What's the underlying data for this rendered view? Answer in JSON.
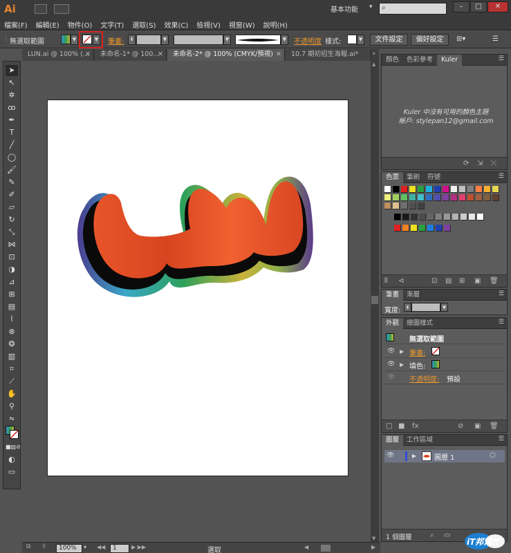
{
  "app": {
    "logo": "Ai",
    "workspace": "基本功能"
  },
  "menu": [
    "檔案(F)",
    "編輯(E)",
    "物件(O)",
    "文字(T)",
    "選取(S)",
    "效果(C)",
    "檢視(V)",
    "視窗(W)",
    "說明(H)"
  ],
  "control": {
    "selection_label": "無選取範圍",
    "stroke_label": "筆畫:",
    "opacity_label": "不透明度",
    "style_label": "樣式:",
    "doc_setup": "文件設定",
    "preferences": "偏好設定"
  },
  "tabs": [
    {
      "label": "LUN.ai @ 100% (...",
      "close": "✕"
    },
    {
      "label": "未命名-1* @ 100...",
      "close": "✕"
    },
    {
      "label": "未命名-2* @ 100% (CMYK/預視)",
      "close": "✕"
    },
    {
      "label": "10.7 期初招生海報.ai*",
      "close": "✕"
    }
  ],
  "canvas": {
    "art_text": "LUN"
  },
  "status": {
    "zoom": "100%",
    "page": "1",
    "tool": "選取"
  },
  "kuler_panel": {
    "tabs": [
      "顏色",
      "色彩參考",
      "Kuler"
    ],
    "message": "Kuler 中沒有可用的顏色主題",
    "account": "帳戶: stylepan12@gmail.com"
  },
  "swatches_panel": {
    "tabs": [
      "色票",
      "筆刷",
      "符號"
    ],
    "colors": [
      "#ffffff",
      "#000000",
      "#e02020",
      "#f0e020",
      "#28a040",
      "#20b0e0",
      "#2040b0",
      "#d0108c",
      "#f0f0f0",
      "#c0c0c0",
      "#808080",
      "#ff8040",
      "#ffb030",
      "#e8d850",
      "#f0f080",
      "#a0d060",
      "#60c060",
      "#40b0a0",
      "#40c0d0",
      "#3070c0",
      "#5050b0",
      "#8040a0",
      "#b03080",
      "#e04070",
      "#c05030",
      "#a06040",
      "#806040",
      "#604030",
      "#c09060",
      "#e0c090",
      "#707070",
      "#505050",
      "#404040"
    ],
    "grays": [
      "#000000",
      "#1a1a1a",
      "#333333",
      "#4d4d4d",
      "#666666",
      "#808080",
      "#999999",
      "#b3b3b3",
      "#cccccc",
      "#e6e6e6",
      "#ffffff"
    ],
    "row6": [
      "#e02020",
      "#f08020",
      "#f0e020",
      "#28a040",
      "#2080e0",
      "#2040b0",
      "#8040a0"
    ]
  },
  "stroke_panel": {
    "tabs": [
      "筆畫",
      "漸層"
    ],
    "weight_label": "寬度:"
  },
  "appearance_panel": {
    "tabs": [
      "外觀",
      "繪圖樣式"
    ],
    "title": "無選取範圍",
    "stroke": "筆畫:",
    "fill": "填色:",
    "opacity": "不透明度:",
    "opacity_value": "預設"
  },
  "layers_panel": {
    "tabs": [
      "圖層",
      "工作區域"
    ],
    "layer_name": "圖層 1",
    "count": "1 個圖層"
  },
  "watermark": {
    "text": "iT邦幫忙"
  },
  "colors": {
    "accent_orange": "#e8962e",
    "highlight_red": "#d42020",
    "layer_selected": "#6f7586"
  }
}
